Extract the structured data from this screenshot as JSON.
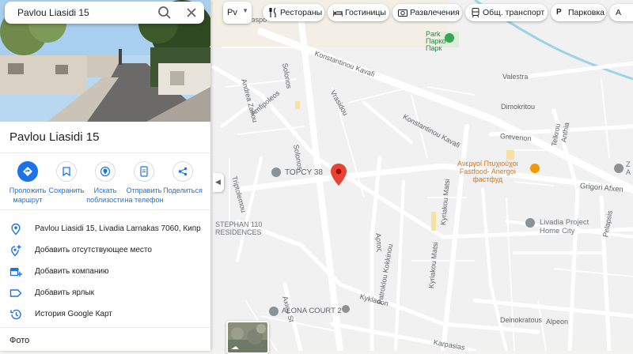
{
  "search": {
    "value": "Pavlou Liasidi 15",
    "search_icon": "search-icon",
    "close_icon": "close-icon"
  },
  "place": {
    "title": "Pavlou Liasidi 15"
  },
  "actions": [
    {
      "label": "Проложить маршрут",
      "icon": "directions-icon"
    },
    {
      "label": "Сохранить",
      "icon": "bookmark-icon"
    },
    {
      "label": "Искать поблизости",
      "icon": "nearby-icon"
    },
    {
      "label": "Отправить на телефон",
      "icon": "phone-icon"
    },
    {
      "label": "Поделиться",
      "icon": "share-icon"
    }
  ],
  "info_rows": [
    {
      "text": "Pavlou Liasidi 15, Livadia Larnakas 7060, Кипр",
      "icon": "location-pin-icon"
    },
    {
      "text": "Добавить отсутствующее место",
      "icon": "add-place-icon"
    },
    {
      "text": "Добавить компанию",
      "icon": "add-business-icon"
    },
    {
      "text": "Добавить ярлык",
      "icon": "label-icon"
    },
    {
      "text": "История Google Карт",
      "icon": "history-icon"
    }
  ],
  "photos_heading": "Фото",
  "layer_toggle": {
    "label": "Pv"
  },
  "chips": [
    {
      "label": "Рестораны",
      "icon": "restaurant-icon"
    },
    {
      "label": "Гостиницы",
      "icon": "hotel-icon"
    },
    {
      "label": "Развлечения",
      "icon": "camera-icon"
    },
    {
      "label": "Общ. транспорт",
      "icon": "transit-icon"
    },
    {
      "label": "Парковка",
      "icon": "parking-icon"
    },
    {
      "label": "А",
      "icon": ""
    }
  ],
  "map": {
    "pois": {
      "park": "Park\nПарко\nПарк",
      "topcy": "TOPCY 38",
      "stephan": "STEPHAN 110\nRESIDENCES",
      "anergoi": "Ανεργοί Πτυχιούχοι\nFastfood- Anergoi\nфастфуд",
      "livadia": "Livadia Project\nHome City",
      "alona": "ALONA COURT 2",
      "edge_z": "Z\nA"
    },
    "streets": {
      "konstantinou1": "Konstantinou Kavafi",
      "konstantinou2": "Konstantinou Kavafi",
      "andrea": "Andrea Zakou",
      "solonos1": "Solonos",
      "solonos2": "Solonos",
      "vrasidou": "Vrasidou",
      "amfipoleos": "Amfipoleos",
      "triptolemou": "Triptolemou",
      "valestra": "Valestra",
      "dimokritou": "Dimokritou",
      "grevenon": "Grevenon",
      "telkrou": "Telkrou",
      "anthia": "Anthia",
      "grigori": "Grigori Afxen",
      "kyriakou": "Kyriakou Matsi",
      "kyriakou2": "Kyriakou Matsi",
      "artos": "Αρτος",
      "patroklou": "Patroklou Kokkinou",
      "axiou": "Axiou St",
      "kykladon": "Kykladon",
      "deinokratous": "Deinokratous",
      "alpeon": "Alpeon",
      "karpasias": "Karpasias",
      "pelapsis": "Pelapsis",
      "top_frag": "эspo"
    }
  },
  "colors": {
    "accent": "#1a73e8",
    "pin": "#ea4335",
    "water": "#9bd3e8"
  }
}
